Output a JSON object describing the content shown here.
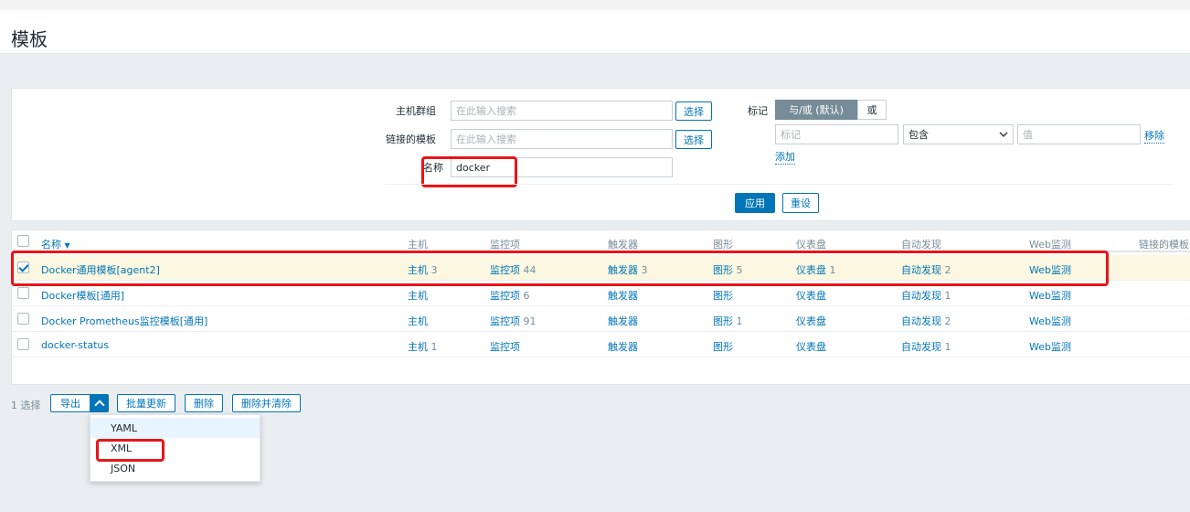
{
  "page": {
    "title": "模板"
  },
  "filter": {
    "host_groups": {
      "label": "主机群组",
      "placeholder": "在此输入搜索",
      "button": "选择"
    },
    "linked_templates": {
      "label": "链接的模板",
      "placeholder": "在此输入搜索",
      "button": "选择"
    },
    "name": {
      "label": "名称",
      "value": "docker"
    },
    "tags": {
      "label": "标记",
      "mode_and_or": "与/或 (默认)",
      "mode_or": "或",
      "tag_placeholder": "标记",
      "operator": "包含",
      "value_placeholder": "值",
      "remove": "移除",
      "add": "添加"
    },
    "apply": "应用",
    "reset": "重设"
  },
  "table": {
    "columns": [
      "名称",
      "主机",
      "监控项",
      "触发器",
      "图形",
      "仪表盘",
      "自动发现",
      "Web监测",
      "链接的模板"
    ],
    "sort_indicator": "▼",
    "rows": [
      {
        "checked": true,
        "name": "Docker通用模板[agent2]",
        "hosts_label": "主机",
        "hosts_count": "3",
        "items_label": "监控项",
        "items_count": "44",
        "triggers_label": "触发器",
        "triggers_count": "3",
        "graphs_label": "图形",
        "graphs_count": "5",
        "dashboards_label": "仪表盘",
        "dashboards_count": "1",
        "discovery_label": "自动发现",
        "discovery_count": "2",
        "web_label": "Web监测"
      },
      {
        "checked": false,
        "name": "Docker模板[通用]",
        "hosts_label": "主机",
        "hosts_count": "",
        "items_label": "监控项",
        "items_count": "6",
        "triggers_label": "触发器",
        "triggers_count": "",
        "graphs_label": "图形",
        "graphs_count": "",
        "dashboards_label": "仪表盘",
        "dashboards_count": "",
        "discovery_label": "自动发现",
        "discovery_count": "1",
        "web_label": "Web监测"
      },
      {
        "checked": false,
        "name": "Docker Prometheus监控模板[通用]",
        "hosts_label": "主机",
        "hosts_count": "",
        "items_label": "监控项",
        "items_count": "91",
        "triggers_label": "触发器",
        "triggers_count": "",
        "graphs_label": "图形",
        "graphs_count": "1",
        "dashboards_label": "仪表盘",
        "dashboards_count": "",
        "discovery_label": "自动发现",
        "discovery_count": "2",
        "web_label": "Web监测"
      },
      {
        "checked": false,
        "name": "docker-status",
        "hosts_label": "主机",
        "hosts_count": "1",
        "items_label": "监控项",
        "items_count": "",
        "triggers_label": "触发器",
        "triggers_count": "",
        "graphs_label": "图形",
        "graphs_count": "",
        "dashboards_label": "仪表盘",
        "dashboards_count": "",
        "discovery_label": "自动发现",
        "discovery_count": "1",
        "web_label": "Web监测"
      }
    ]
  },
  "footer": {
    "selected_count": "1 选择",
    "export": "导出",
    "mass_update": "批量更新",
    "delete": "删除",
    "delete_and_clear": "删除并清除"
  },
  "export_menu": [
    "YAML",
    "XML",
    "JSON"
  ],
  "colors": {
    "accent": "#0275b8",
    "highlight": "#e8151b",
    "selected_row": "#fbf7e0"
  }
}
